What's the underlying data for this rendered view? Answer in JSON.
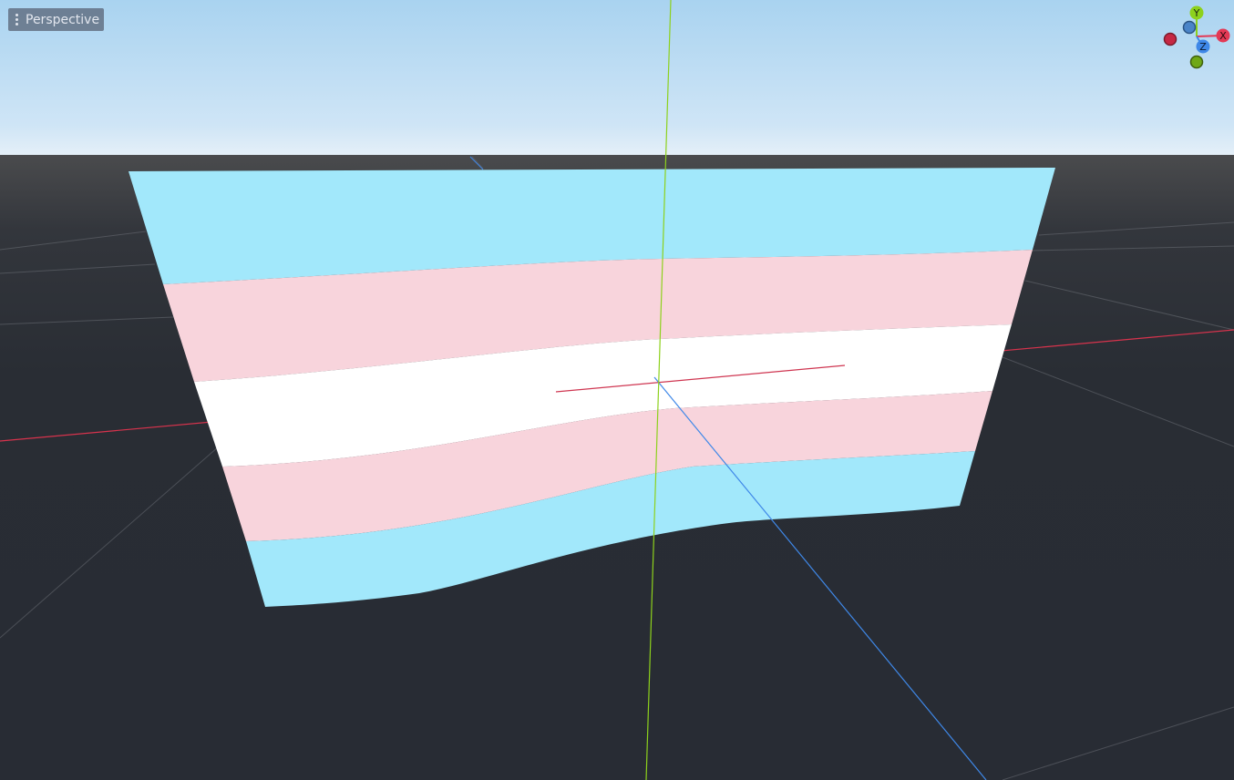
{
  "viewport": {
    "view_menu_label": "Perspective"
  },
  "gizmo": {
    "x_label": "X",
    "y_label": "Y",
    "z_label": "Z"
  },
  "colors": {
    "sky_top": "#a9d3f0",
    "sky_horizon": "#e2eef8",
    "ground": "#282c34",
    "flag_blue": "#a2e8fb",
    "flag_pink": "#f8d4dc",
    "flag_white": "#ffffff",
    "axis_x": "#e33955",
    "axis_y": "#8dd11c",
    "axis_z": "#3f88e8"
  }
}
